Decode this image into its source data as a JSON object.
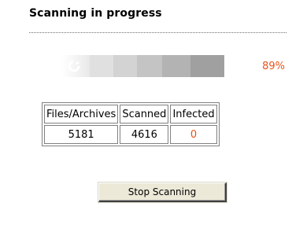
{
  "header": {
    "title": "Scanning in progress"
  },
  "progress": {
    "value": 0.89,
    "label": "89%",
    "icon": "spinner-icon",
    "color": "#e8541b"
  },
  "stats": {
    "columns": [
      "Files/Archives",
      "Scanned",
      "Infected"
    ],
    "values": [
      "5181",
      "4616",
      "0"
    ],
    "infected_color": "#e8541b"
  },
  "actions": {
    "stop_label": "Stop Scanning"
  }
}
